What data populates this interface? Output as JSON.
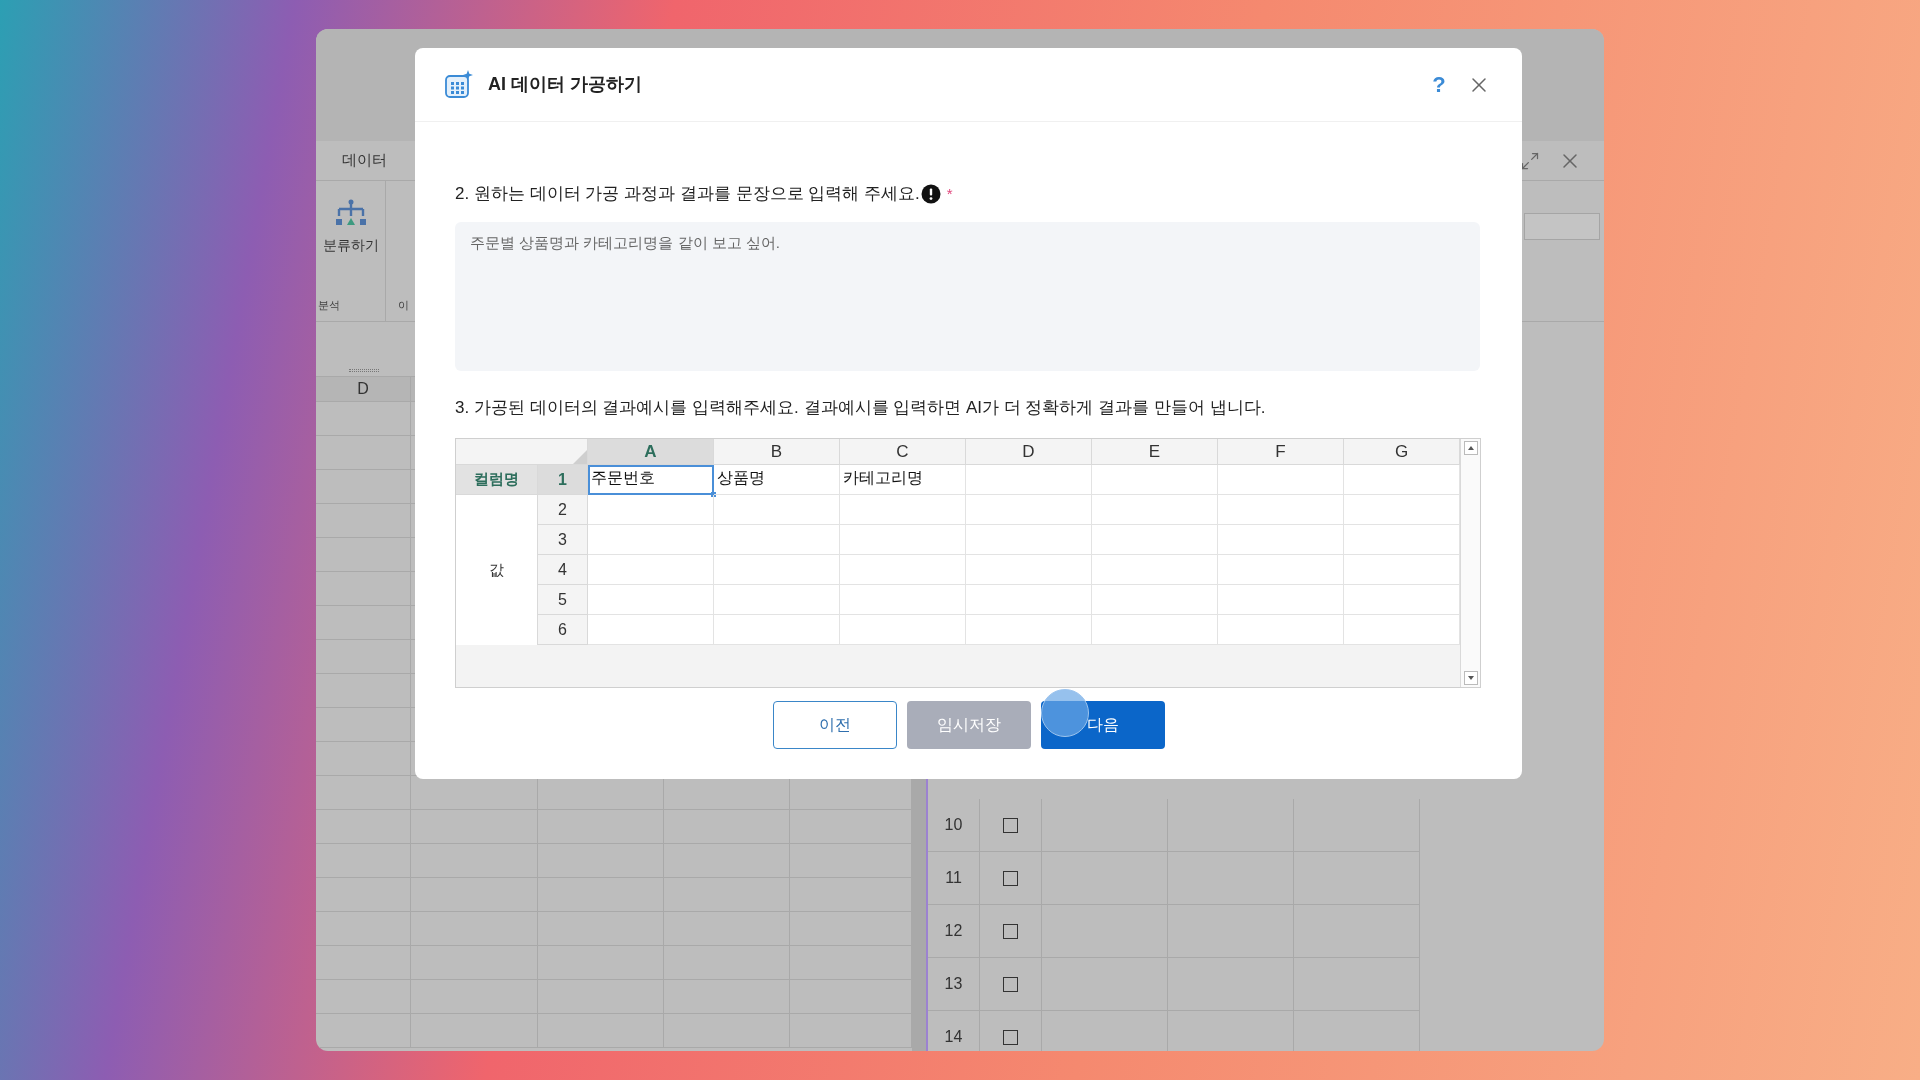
{
  "background_window": {
    "ribbon_tab": "데이터",
    "ribbon_button": "분류하기",
    "ribbon_groups": [
      "분석",
      "이"
    ],
    "sheet_column": "D",
    "side_rows": [
      {
        "number": "10",
        "checked": false
      },
      {
        "number": "11",
        "checked": false
      },
      {
        "number": "12",
        "checked": false
      },
      {
        "number": "13",
        "checked": false
      },
      {
        "number": "14",
        "checked": false
      }
    ]
  },
  "dialog": {
    "title": "AI 데이터 가공하기",
    "help": "?",
    "question_2": {
      "label": "2. 원하는 데이터 가공 과정과 결과를 문장으로 입력해 주세요.",
      "required_mark": "*",
      "value": "주문별 상품명과 카테고리명을 같이 보고 싶어."
    },
    "question_3": {
      "label": "3. 가공된 데이터의 결과예시를 입력해주세요. 결과예시를 입력하면 AI가 더 정확하게 결과를 만들어 냅니다."
    },
    "sheet": {
      "header_label": "컬럼명",
      "value_label": "값",
      "columns": [
        {
          "label": "A",
          "selected": true
        },
        {
          "label": "B",
          "selected": false
        },
        {
          "label": "C",
          "selected": false
        },
        {
          "label": "D",
          "selected": false
        },
        {
          "label": "E",
          "selected": false
        },
        {
          "label": "F",
          "selected": false
        },
        {
          "label": "G",
          "selected": false
        }
      ],
      "rows": [
        {
          "number": "1",
          "selected": true,
          "cells": [
            "주문번호",
            "상품명",
            "카테고리명"
          ]
        },
        {
          "number": "2",
          "selected": false
        },
        {
          "number": "3",
          "selected": false
        },
        {
          "number": "4",
          "selected": false
        },
        {
          "number": "5",
          "selected": false
        },
        {
          "number": "6",
          "selected": false
        }
      ]
    },
    "buttons": [
      {
        "label": "이전",
        "kind": "outline"
      },
      {
        "label": "임시저장",
        "kind": "muted"
      },
      {
        "label": "다음",
        "kind": "primary"
      }
    ]
  }
}
